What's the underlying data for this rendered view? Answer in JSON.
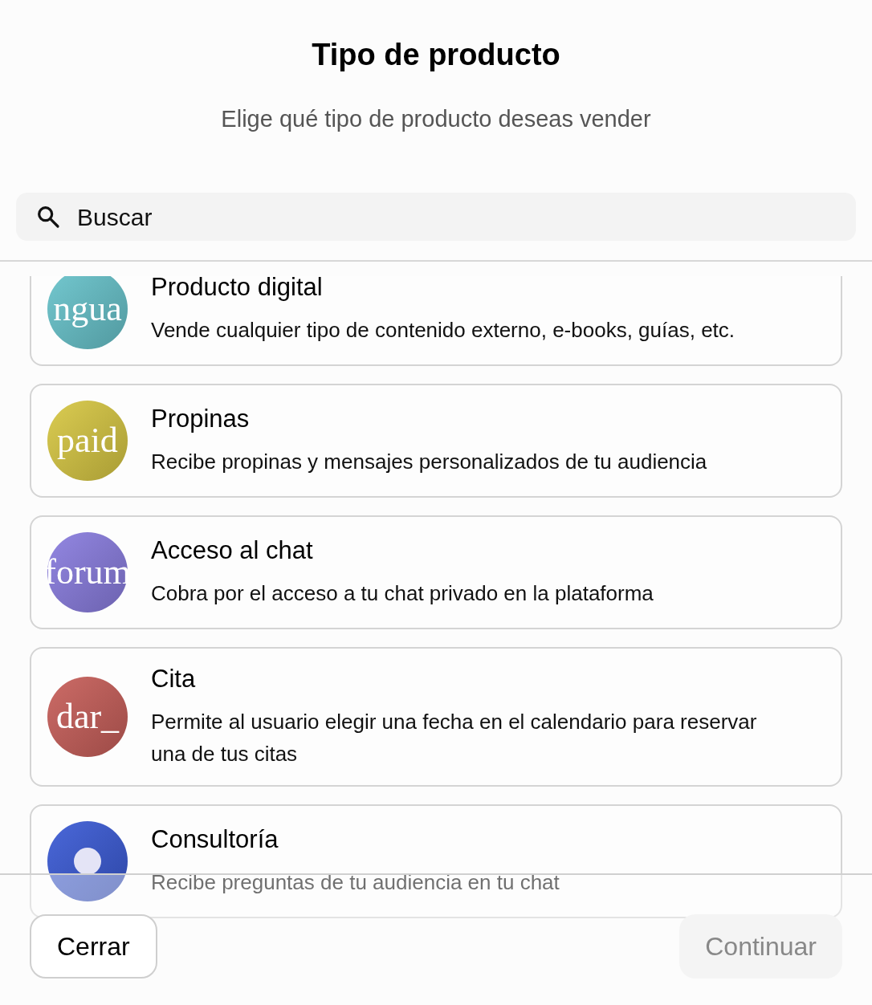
{
  "title": "Tipo de producto",
  "subtitle": "Elige qué tipo de producto deseas vender",
  "search": {
    "placeholder": "Buscar"
  },
  "products": [
    {
      "kind": "text",
      "glyph": "ngua",
      "title": "Producto digital",
      "description": "Vende cualquier tipo de contenido externo, e-books, guías, etc.",
      "color": "#68c4cc"
    },
    {
      "kind": "text",
      "glyph": "paid",
      "title": "Propinas",
      "description": "Recibe propinas y mensajes personalizados de tu audiencia",
      "color": "#d8c843"
    },
    {
      "kind": "text",
      "glyph": "forum",
      "title": "Acceso al chat",
      "description": "Cobra por el acceso a tu chat privado en la plataforma",
      "color": "#8a7de0"
    },
    {
      "kind": "text",
      "glyph": "dar_",
      "title": "Cita",
      "description": "Permite al usuario elegir una fecha en el calendario para reservar una de tus citas",
      "color": "#c85f5a"
    },
    {
      "kind": "dot",
      "title": "Consultoría",
      "description": "Recibe preguntas de tu audiencia en tu chat",
      "color": "#3b5bd6"
    }
  ],
  "buttons": [
    {
      "label": "Cerrar",
      "disabled": false
    },
    {
      "label": "Continuar",
      "disabled": true
    }
  ]
}
